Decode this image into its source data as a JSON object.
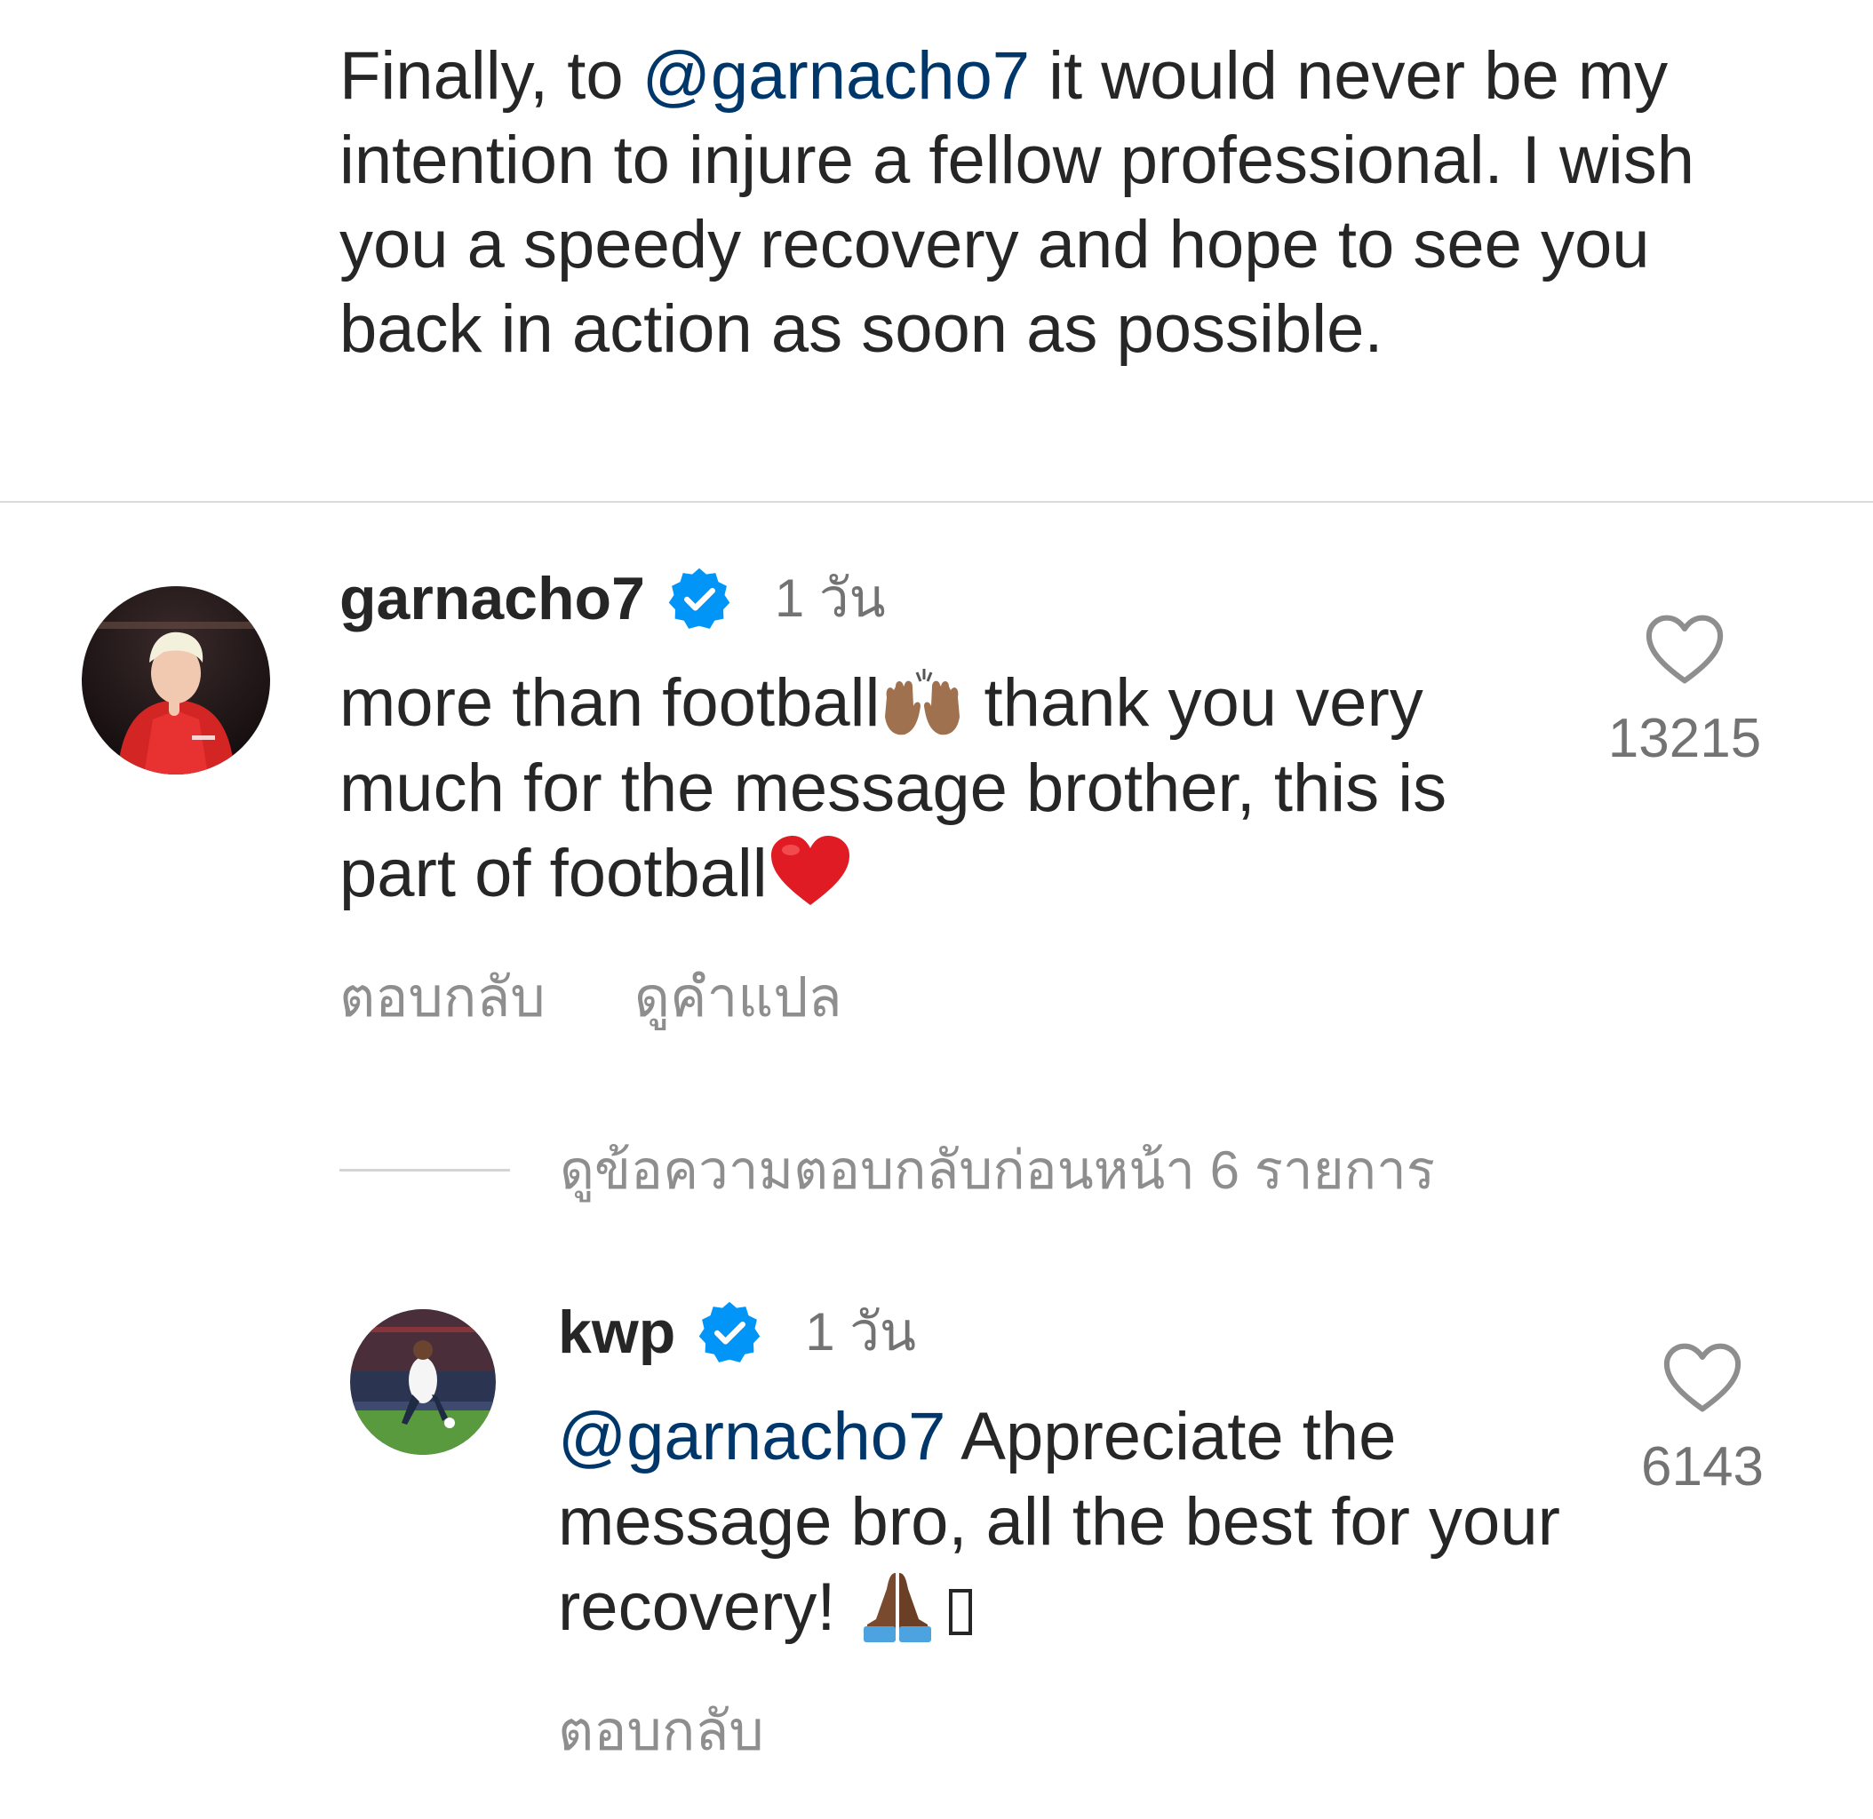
{
  "post_caption": {
    "prefix": "Finally, to ",
    "mention": "@garnacho7",
    "text": " it would never be my intention to injure a fellow professional. I wish you a speedy recovery and hope to see you back in action as soon as possible."
  },
  "comments": [
    {
      "username": "garnacho7",
      "verified": true,
      "time": "1 วัน",
      "text_part1": "more than football",
      "emoji_1": "raising-hands-medium-dark-skin-emoji",
      "text_part2": " thank you very much for the message brother, this is part of football",
      "emoji_2": "red-heart-emoji",
      "likes": "13215",
      "actions": {
        "reply": "ตอบกลับ",
        "translate": "ดูคำแปล"
      }
    },
    {
      "username": "kwp",
      "verified": true,
      "time": "1 วัน",
      "mention": "@garnacho7",
      "text": " Appreciate the message bro, all the best for your recovery! ",
      "emoji_1": "folded-hands-dark-skin-emoji",
      "likes": "6143",
      "actions": {
        "reply": "ตอบกลับ"
      }
    }
  ],
  "view_previous_replies": "ดูข้อความตอบกลับก่อนหน้า 6 รายการ",
  "colors": {
    "text": "#262626",
    "mention": "#00376b",
    "muted": "#8e8e8e",
    "verified_blue": "#0095f6",
    "divider": "#dbdbdb"
  }
}
